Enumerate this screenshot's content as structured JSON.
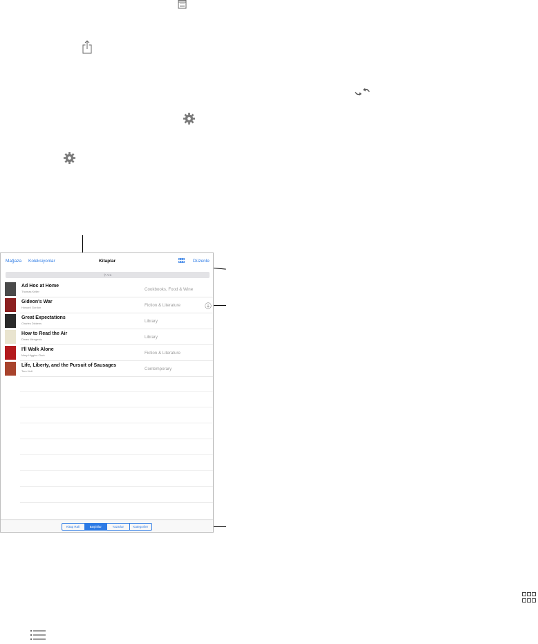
{
  "icons": {
    "list_icon_top": "list-view-icon",
    "share": "share-icon",
    "flip": "flip-icon",
    "gear_1": "gear-icon",
    "gear_2": "gear-icon",
    "grid_bottom": "grid-view-icon",
    "list_bottom": "list-view-icon"
  },
  "nav": {
    "store": "Mağaza",
    "collections": "Koleksiyonlar",
    "title": "Kitaplar",
    "edit": "Düzenle"
  },
  "search": {
    "placeholder": "Ara"
  },
  "books": [
    {
      "title": "Ad Hoc at Home",
      "author": "Thomas Keller",
      "category": "Cookbooks, Food & Wine",
      "cover": "#4a4a4a",
      "cloud": false
    },
    {
      "title": "Gideon's War",
      "author": "Howard Gordon",
      "category": "Fiction & Literature",
      "cover": "#8b1f1f",
      "cloud": true
    },
    {
      "title": "Great Expectations",
      "author": "Charles Dickens",
      "category": "Library",
      "cover": "#2a2a2a",
      "cloud": false
    },
    {
      "title": "How to Read the Air",
      "author": "Dinaw Mengestu",
      "category": "Library",
      "cover": "#e9e4cf",
      "cloud": false
    },
    {
      "title": "I'll Walk Alone",
      "author": "Mary Higgins Clark",
      "category": "Fiction & Literature",
      "cover": "#b3191c",
      "cloud": false
    },
    {
      "title": "Life, Liberty, and the Pursuit of Sausages",
      "author": "Tom Holt",
      "category": "Contemporary",
      "cover": "#a8432c",
      "cloud": false
    }
  ],
  "tabs": [
    "Kitap Rafı",
    "Başlıklar",
    "Yazarlar",
    "Kategoriler"
  ],
  "colors": {
    "accent": "#2d7be5"
  }
}
